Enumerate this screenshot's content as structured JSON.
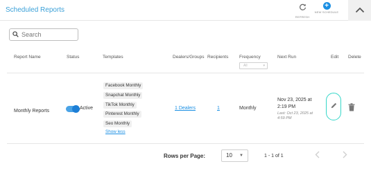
{
  "header": {
    "title": "Scheduled Reports",
    "refresh_label": "REFRESH",
    "new_schedule_label": "NEW SCHEDULE"
  },
  "search": {
    "placeholder": "Search"
  },
  "columns": {
    "report_name": "Report Name",
    "status": "Status",
    "templates": "Templates",
    "dealers_groups": "Dealers/Groups",
    "recipients": "Recipients",
    "frequency": "Frequency",
    "next_run": "Next Run",
    "edit": "Edit",
    "delete": "Delete"
  },
  "frequency_filter": {
    "selected": "All"
  },
  "row": {
    "report_name": "Monthly Reports",
    "status": "Active",
    "status_on": true,
    "templates": [
      "Facebook Monthly",
      "Snapchat Monthly",
      "TikTok Monthly",
      "Pinterest Monthly",
      "Seo Monthly"
    ],
    "show_less": "Show less",
    "dealers": "1 Dealers",
    "recipients": "1",
    "frequency": "Monthly",
    "next_run_line1": "Nov 23, 2025 at",
    "next_run_line2": "2:19 PM",
    "last_run": "Last: Oct 23, 2025 at 4:59 PM"
  },
  "pagination": {
    "rows_per_page_label": "Rows per Page:",
    "rows_per_page_value": "10",
    "range": "1 - 1 of 1"
  },
  "colors": {
    "accent": "#1a8fe3",
    "title": "#3aa0d8",
    "edit_highlight": "#33d6c8"
  }
}
